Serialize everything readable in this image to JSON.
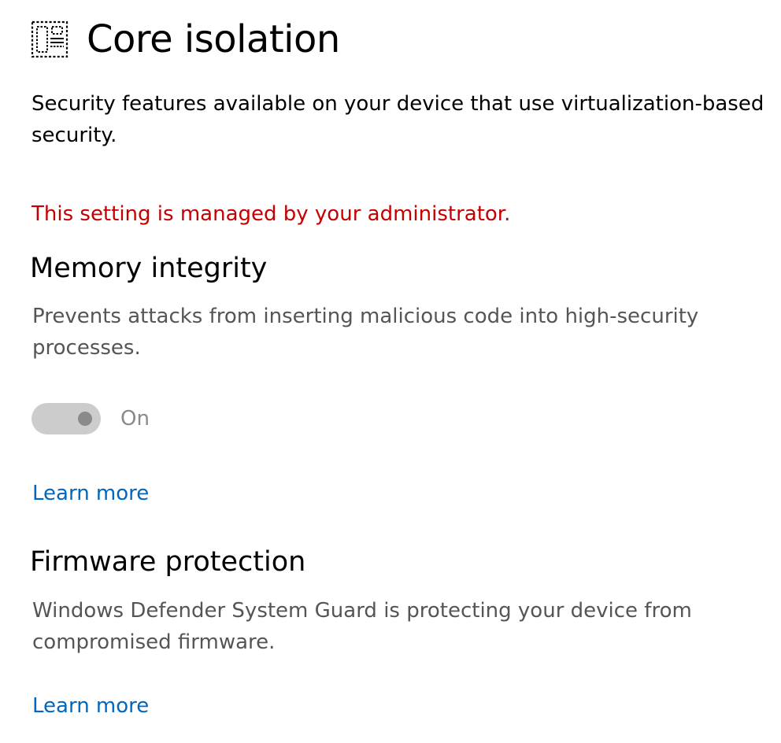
{
  "header": {
    "title": "Core isolation",
    "icon": "core-isolation-icon"
  },
  "description": "Security features available on your device that use virtualization-based security.",
  "admin_notice": "This setting is managed by your administrator.",
  "memory_integrity": {
    "title": "Memory integrity",
    "description": "Prevents attacks from inserting malicious code into high-security processes.",
    "toggle_state": "On",
    "toggle_on": true,
    "toggle_disabled": true,
    "learn_more": "Learn more"
  },
  "firmware_protection": {
    "title": "Firmware protection",
    "description": "Windows Defender System Guard is protecting your device from compromised firmware.",
    "learn_more": "Learn more"
  },
  "colors": {
    "warning": "#c50000",
    "link": "#0067c0",
    "secondary_text": "#555555",
    "disabled": "#8a8a8a"
  }
}
